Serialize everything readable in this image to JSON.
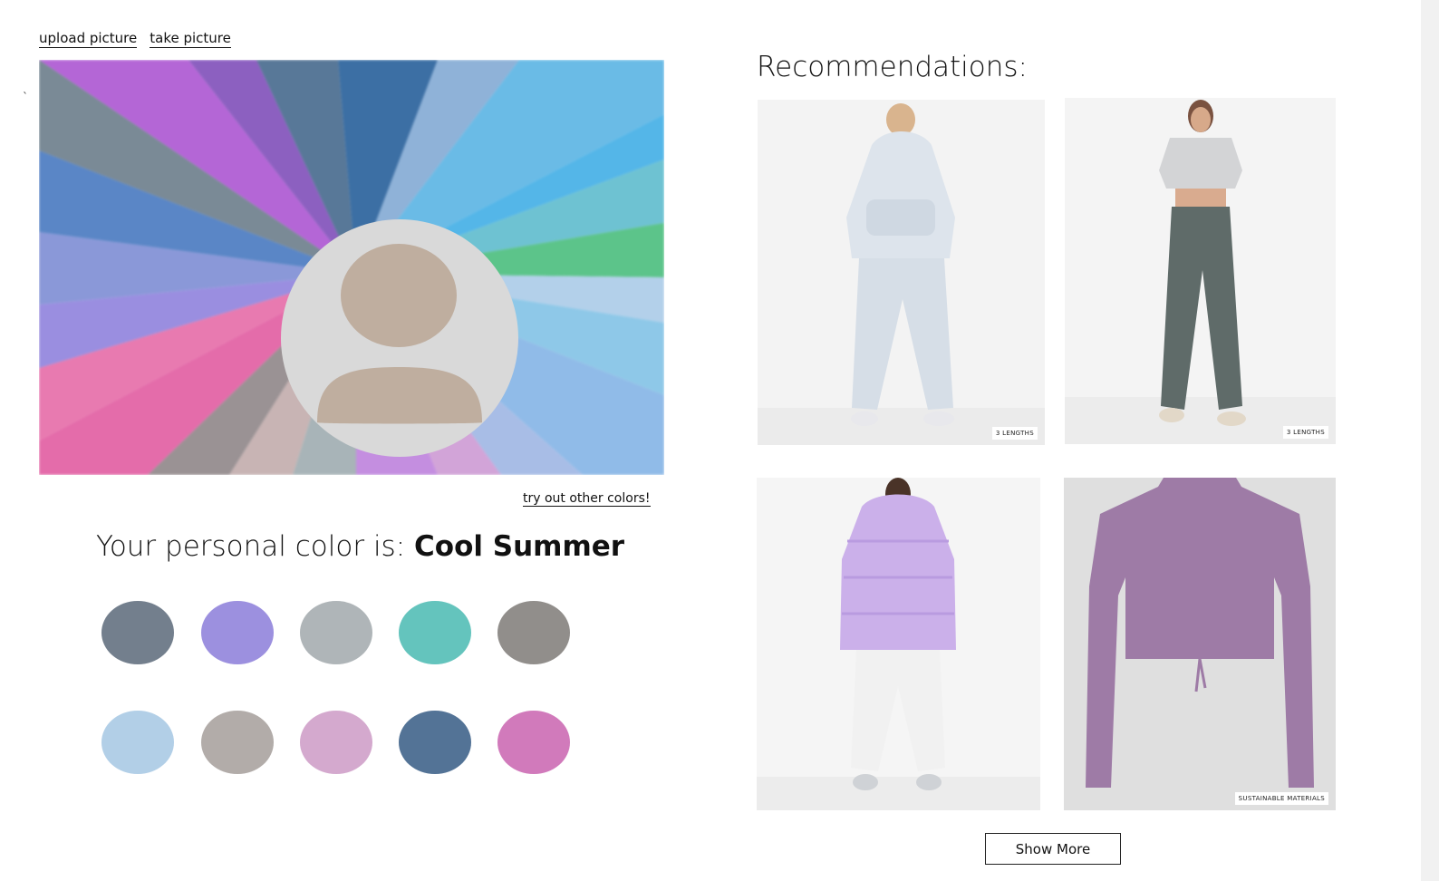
{
  "header": {
    "upload_label": "upload picture",
    "take_label": "take picture",
    "stray_mark": "`"
  },
  "hero": {
    "try_link": "try out other colors!",
    "avatar_icon": "person-silhouette-icon"
  },
  "result": {
    "prefix": "Your personal color is:",
    "season": "Cool Summer"
  },
  "palette": [
    {
      "name": "slate",
      "hex": "#737f8d"
    },
    {
      "name": "lavender",
      "hex": "#9c90df"
    },
    {
      "name": "silver",
      "hex": "#afb5b8"
    },
    {
      "name": "teal",
      "hex": "#64c4bd"
    },
    {
      "name": "grey",
      "hex": "#918e8b"
    },
    {
      "name": "powder-blue",
      "hex": "#b2cfe7"
    },
    {
      "name": "taupe",
      "hex": "#b2aca9"
    },
    {
      "name": "orchid",
      "hex": "#d4a9ce"
    },
    {
      "name": "denim",
      "hex": "#537396"
    },
    {
      "name": "magenta",
      "hex": "#d17abb"
    }
  ],
  "recommendations": {
    "title": "Recommendations:",
    "items": [
      {
        "badge": "3 LENGTHS"
      },
      {
        "badge": "3 LENGTHS"
      },
      {
        "badge": ""
      },
      {
        "badge": "SUSTAINABLE MATERIALS"
      }
    ],
    "show_more": "Show More"
  }
}
